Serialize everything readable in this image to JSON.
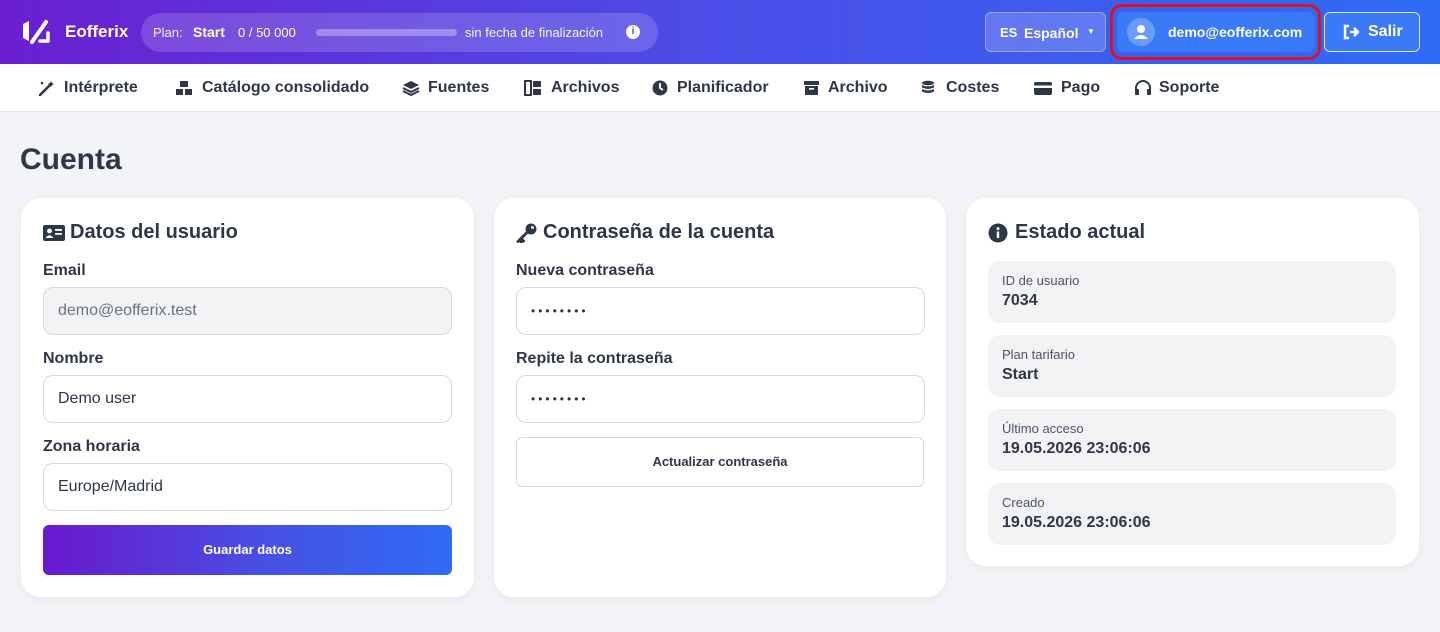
{
  "app": {
    "brand": "Eofferix",
    "plan": {
      "label": "Plan:",
      "name": "Start",
      "usage": "0 / 50 000",
      "progress": 0,
      "end_text": "sin fecha de finalización"
    },
    "language": {
      "code": "ES",
      "name": "Español"
    },
    "user_email": "demo@eofferix.com",
    "logout_label": "Salir",
    "colors": {
      "accent_start": "#6a1fd0",
      "accent_end": "#2f6bf5",
      "highlight": "#d8142a"
    }
  },
  "nav": {
    "items": [
      {
        "label": "Intérprete",
        "icon": "wand-icon"
      },
      {
        "label": "Catálogo consolidado",
        "icon": "catalog-icon"
      },
      {
        "label": "Fuentes",
        "icon": "layers-icon"
      },
      {
        "label": "Archivos",
        "icon": "files-icon"
      },
      {
        "label": "Planificador",
        "icon": "clock-icon"
      },
      {
        "label": "Archivo",
        "icon": "archive-icon"
      },
      {
        "label": "Costes",
        "icon": "coins-icon"
      },
      {
        "label": "Pago",
        "icon": "credit-card-icon"
      },
      {
        "label": "Soporte",
        "icon": "headset-icon"
      }
    ]
  },
  "page": {
    "title": "Cuenta"
  },
  "user_card": {
    "title": "Datos del usuario",
    "email_label": "Email",
    "email_value": "demo@eofferix.test",
    "name_label": "Nombre",
    "name_value": "Demo user",
    "tz_label": "Zona horaria",
    "tz_value": "Europe/Madrid",
    "save_label": "Guardar datos"
  },
  "password_card": {
    "title": "Contraseña de la cuenta",
    "new_label": "Nueva contraseña",
    "new_value": "••••••••",
    "repeat_label": "Repite la contraseña",
    "repeat_value": "••••••••",
    "update_label": "Actualizar contraseña"
  },
  "status_card": {
    "title": "Estado actual",
    "items": [
      {
        "label": "ID de usuario",
        "value": "7034"
      },
      {
        "label": "Plan tarifario",
        "value": "Start"
      },
      {
        "label": "Último acceso",
        "value": "19.05.2026 23:06:06"
      },
      {
        "label": "Creado",
        "value": "19.05.2026 23:06:06"
      }
    ]
  }
}
